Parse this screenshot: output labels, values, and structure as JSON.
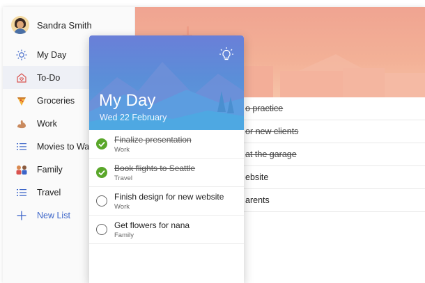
{
  "profile": {
    "name": "Sandra Smith"
  },
  "sidebar": {
    "items": [
      {
        "label": "My Day",
        "icon": "sun-icon"
      },
      {
        "label": "To-Do",
        "icon": "house-icon"
      },
      {
        "label": "Groceries",
        "icon": "pizza-icon"
      },
      {
        "label": "Work",
        "icon": "flexed-arm-icon"
      },
      {
        "label": "Movies to Watch",
        "icon": "list-icon"
      },
      {
        "label": "Family",
        "icon": "family-icon"
      },
      {
        "label": "Travel",
        "icon": "list-icon"
      }
    ],
    "new_list": "New List"
  },
  "background_tasks": [
    {
      "text": "o practice",
      "done": true
    },
    {
      "text": "or new clients",
      "done": true
    },
    {
      "text": "at the garage",
      "done": true
    },
    {
      "text": "ebsite",
      "done": false
    },
    {
      "text": "arents",
      "done": false
    }
  ],
  "my_day": {
    "title": "My Day",
    "date": "Wed 22 February",
    "tasks": [
      {
        "title": "Finalize presentation",
        "list": "Work",
        "done": true
      },
      {
        "title": "Book flights to Seattle",
        "list": "Travel",
        "done": true
      },
      {
        "title": "Finish design for new website",
        "list": "Work",
        "done": false
      },
      {
        "title": "Get flowers for nana",
        "list": "Family",
        "done": false
      }
    ]
  },
  "colors": {
    "accent": "#3b64c8",
    "check_done": "#5aa72a",
    "hero_coral": "#f0a491",
    "card_blue": "#5b8ed8"
  }
}
